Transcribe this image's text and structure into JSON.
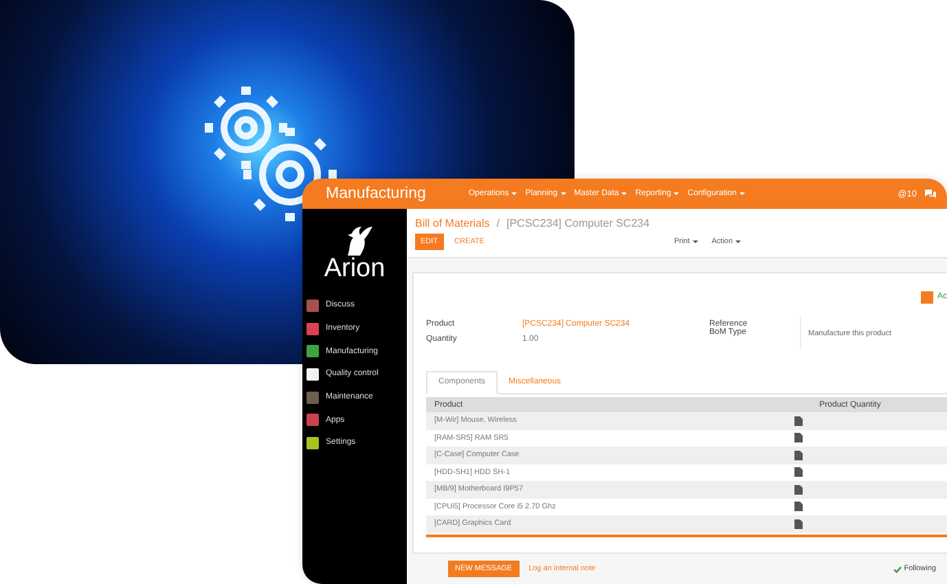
{
  "app": {
    "title": "Manufacturing",
    "menu": [
      {
        "label": "Operations"
      },
      {
        "label": "Planning"
      },
      {
        "label": "Master Data"
      },
      {
        "label": "Reporting"
      },
      {
        "label": "Configuration"
      }
    ],
    "notifications": "@10",
    "logo": "Arion",
    "sidebar": {
      "items": [
        {
          "label": "Discuss",
          "color": "#a8504e"
        },
        {
          "label": "Inventory",
          "color": "#d9434f"
        },
        {
          "label": "Manufacturing",
          "color": "#3fa33f"
        },
        {
          "label": "Quality control",
          "color": "#f2f2f2"
        },
        {
          "label": "Maintenance",
          "color": "#6e5e4c"
        },
        {
          "label": "Apps",
          "color": "#c8434f"
        },
        {
          "label": "Settings",
          "color": "#a6c21e"
        }
      ]
    },
    "breadcrumb": {
      "parent": "Bill of Materials",
      "separator": "/",
      "current": "[PCSC234] Computer SC234"
    },
    "buttons": {
      "edit": "EDIT",
      "create": "CREATE",
      "print": "Print",
      "action": "Action"
    },
    "archive_button": "Ac",
    "fields": [
      {
        "label": "Product",
        "value": "[PCSC234] Computer SC234",
        "kind": "link"
      },
      {
        "label": "Quantity",
        "value": "1.00",
        "kind": "plain"
      }
    ],
    "fields_right": {
      "labels": [
        "Reference",
        "BoM Type"
      ],
      "value": "Manufacture this product"
    },
    "tabs": [
      {
        "label": "Components",
        "selected": true
      },
      {
        "label": "Miscellaneous",
        "selected": false
      }
    ],
    "table": {
      "columns": [
        "Product",
        "Product Quantity"
      ],
      "rows": [
        {
          "product": "[M-Wir] Mouse, Wireless"
        },
        {
          "product": "[RAM-SR5] RAM SR5"
        },
        {
          "product": "[C-Case] Computer Case"
        },
        {
          "product": "[HDD-SH1] HDD SH-1"
        },
        {
          "product": "[MB/9] Motherboard I9P57"
        },
        {
          "product": "[CPUi5] Processor Core i5 2.70 Ghz"
        },
        {
          "product": "[CARD] Graphics Card"
        }
      ]
    },
    "chatter": {
      "new_message": "NEW MESSAGE",
      "log_note": "Log an internal note",
      "following": "Following"
    }
  }
}
